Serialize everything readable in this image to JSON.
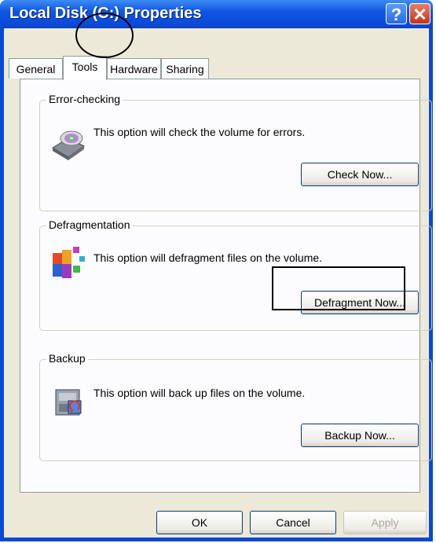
{
  "window": {
    "title": "Local Disk (C:) Properties",
    "help_glyph": "?",
    "close_glyph": "✕"
  },
  "tabs": [
    {
      "label": "General",
      "active": false
    },
    {
      "label": "Tools",
      "active": true
    },
    {
      "label": "Hardware",
      "active": false
    },
    {
      "label": "Sharing",
      "active": false
    }
  ],
  "sections": {
    "error_checking": {
      "title": "Error-checking",
      "text": "This option will check the volume for errors.",
      "button": "Check Now..."
    },
    "defragmentation": {
      "title": "Defragmentation",
      "text": "This option will defragment files on the volume.",
      "button": "Defragment Now..."
    },
    "backup": {
      "title": "Backup",
      "text": "This option will back up files on the volume.",
      "button": "Backup Now..."
    }
  },
  "footer": {
    "ok": "OK",
    "cancel": "Cancel",
    "apply": "Apply",
    "apply_enabled": false
  },
  "icons": {
    "error_checking": "disk-check-icon",
    "defragmentation": "defragment-icon",
    "backup": "backup-icon"
  }
}
